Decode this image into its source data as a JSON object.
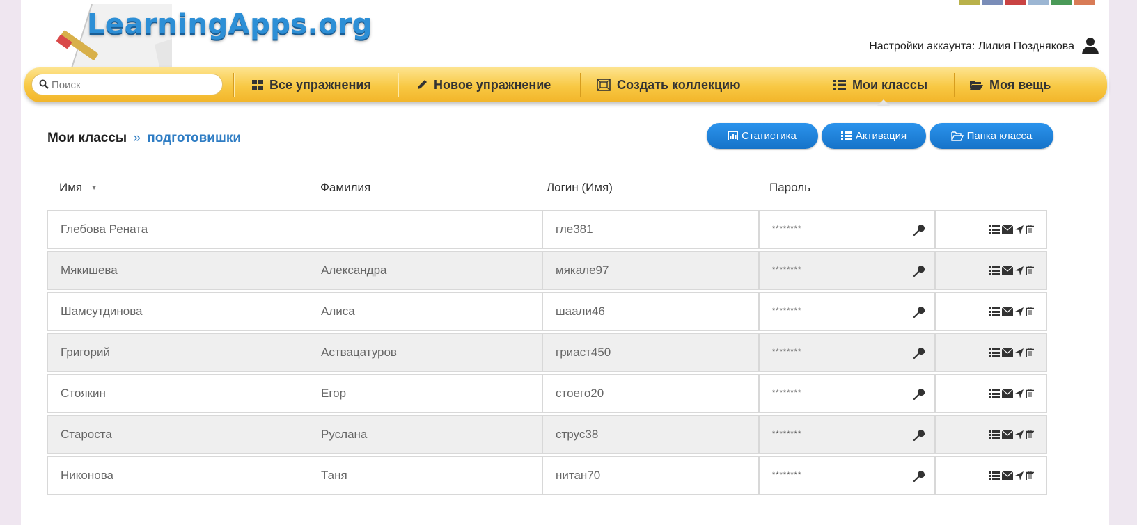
{
  "brand": {
    "logo": "LearningApps.org"
  },
  "header": {
    "account_text": "Настройки аккаунта: Лилия Позднякова",
    "account_icon": "user-icon"
  },
  "nav": {
    "search_placeholder": "Поиск",
    "items": [
      {
        "label": "Все упражнения",
        "icon": "grid-icon"
      },
      {
        "label": "Новое упражнение",
        "icon": "pencil-icon"
      },
      {
        "label": "Создать коллекцию",
        "icon": "collection-icon"
      },
      {
        "label": "Мои классы",
        "icon": "list-icon",
        "active": true
      },
      {
        "label": "Моя вещь",
        "icon": "folder-icon"
      }
    ]
  },
  "breadcrumb": {
    "root": "Мои классы",
    "separator": "»",
    "current": "подготовишки"
  },
  "buttons": {
    "stats": "Статистика",
    "activation": "Активация",
    "class_folder": "Папка класса"
  },
  "table": {
    "headers": {
      "first_name": "Имя",
      "last_name": "Фамилия",
      "login": "Логин (Имя)",
      "password": "Пароль"
    },
    "rows": [
      {
        "first": "Глебова Рената",
        "last": "",
        "login": "гле381",
        "password": "********"
      },
      {
        "first": "Мякишева",
        "last": "Александра",
        "login": "мякале97",
        "password": "********"
      },
      {
        "first": "Шамсутдинова",
        "last": "Алиса",
        "login": "шаали46",
        "password": "********"
      },
      {
        "first": "Григорий",
        "last": "Аствацатуров",
        "login": "гриаст450",
        "password": "********"
      },
      {
        "first": "Стоякин",
        "last": "Егор",
        "login": "стоего20",
        "password": "********"
      },
      {
        "first": "Староста",
        "last": "Руслана",
        "login": "струс38",
        "password": "********"
      },
      {
        "first": "Никонова",
        "last": "Таня",
        "login": "нитан70",
        "password": "********"
      }
    ]
  },
  "colors": {
    "nav_yellow": "#f8c843",
    "accent_blue": "#2f7dc4",
    "button_blue": "#1f84dd"
  }
}
